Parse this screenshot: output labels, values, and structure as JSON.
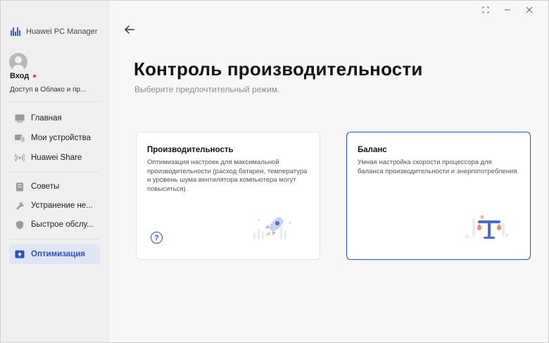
{
  "app": {
    "name": "Huawei PC Manager"
  },
  "account": {
    "login": "Вход",
    "cloud_text": "Доступ в Облако и пр..."
  },
  "nav": {
    "home": "Главная",
    "devices": "Мои устройства",
    "share": "Huawei Share",
    "tips": "Советы",
    "troubleshoot": "Устранение не...",
    "service": "Быстрое обслу...",
    "optimize": "Оптимизация"
  },
  "page": {
    "title": "Контроль производительности",
    "subtitle": "Выберите предпочтительный режим."
  },
  "modes": [
    {
      "title": "Производительность",
      "description": "Оптимизация настроек для максимальной производительности (расход батареи, температура и уровень шума вентилятора компьютера могут повыситься).",
      "selected": false
    },
    {
      "title": "Баланс",
      "description": "Умная настройка скорости процессора для баланса производительности и энергопотребления.",
      "selected": true
    }
  ],
  "help": {
    "glyph": "?"
  },
  "colors": {
    "accent": "#2a4fc7",
    "notification": "#e23b2e",
    "sidebar_active_bg": "#e1e6f4"
  },
  "icons": [
    "back-arrow-icon",
    "help-icon",
    "rocket-icon",
    "scales-icon",
    "home-icon",
    "devices-icon",
    "share-icon",
    "tips-icon",
    "wrench-icon",
    "shield-icon",
    "optimize-icon"
  ]
}
